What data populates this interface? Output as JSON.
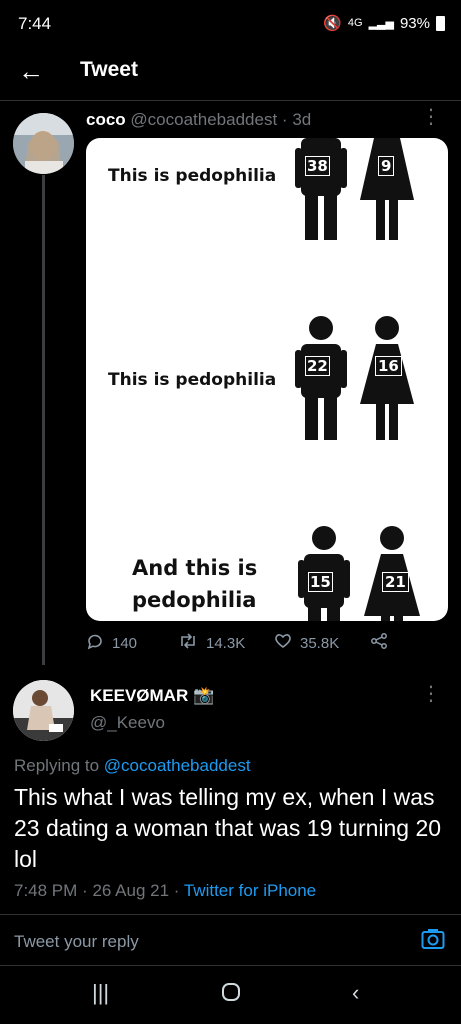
{
  "status": {
    "time": "7:44",
    "network": "4G",
    "battery": "93%"
  },
  "header": {
    "title": "Tweet",
    "back_icon": "arrow-left-icon"
  },
  "original_tweet": {
    "display_name": "coco",
    "handle": "@cocoathebaddest",
    "age": "3d",
    "image": {
      "rows": [
        {
          "caption": "This is pedophilia",
          "left_num": "38",
          "right_num": "9"
        },
        {
          "caption": "This is pedophilia",
          "left_num": "22",
          "right_num": "16"
        },
        {
          "caption_line1": "And this is",
          "caption_line2": "pedophilia",
          "left_num": "15",
          "right_num": "21"
        }
      ]
    },
    "stats": {
      "replies": "140",
      "retweets": "14.3K",
      "likes": "35.8K"
    }
  },
  "reply_tweet": {
    "display_name": "KEEVØMAR",
    "badge_icon": "camera-emoji-icon",
    "handle": "@_Keevo",
    "replying_prefix": "Replying to",
    "replying_to": "@cocoathebaddest",
    "text": "This what I was telling my ex, when I was 23 dating a woman that was 19 turning 20 lol",
    "time": "7:48 PM",
    "date": "26 Aug 21",
    "source": "Twitter for iPhone"
  },
  "composer": {
    "placeholder": "Tweet your reply"
  },
  "colors": {
    "background": "#000000",
    "accent": "#1d9bf0",
    "muted": "#71767b"
  }
}
